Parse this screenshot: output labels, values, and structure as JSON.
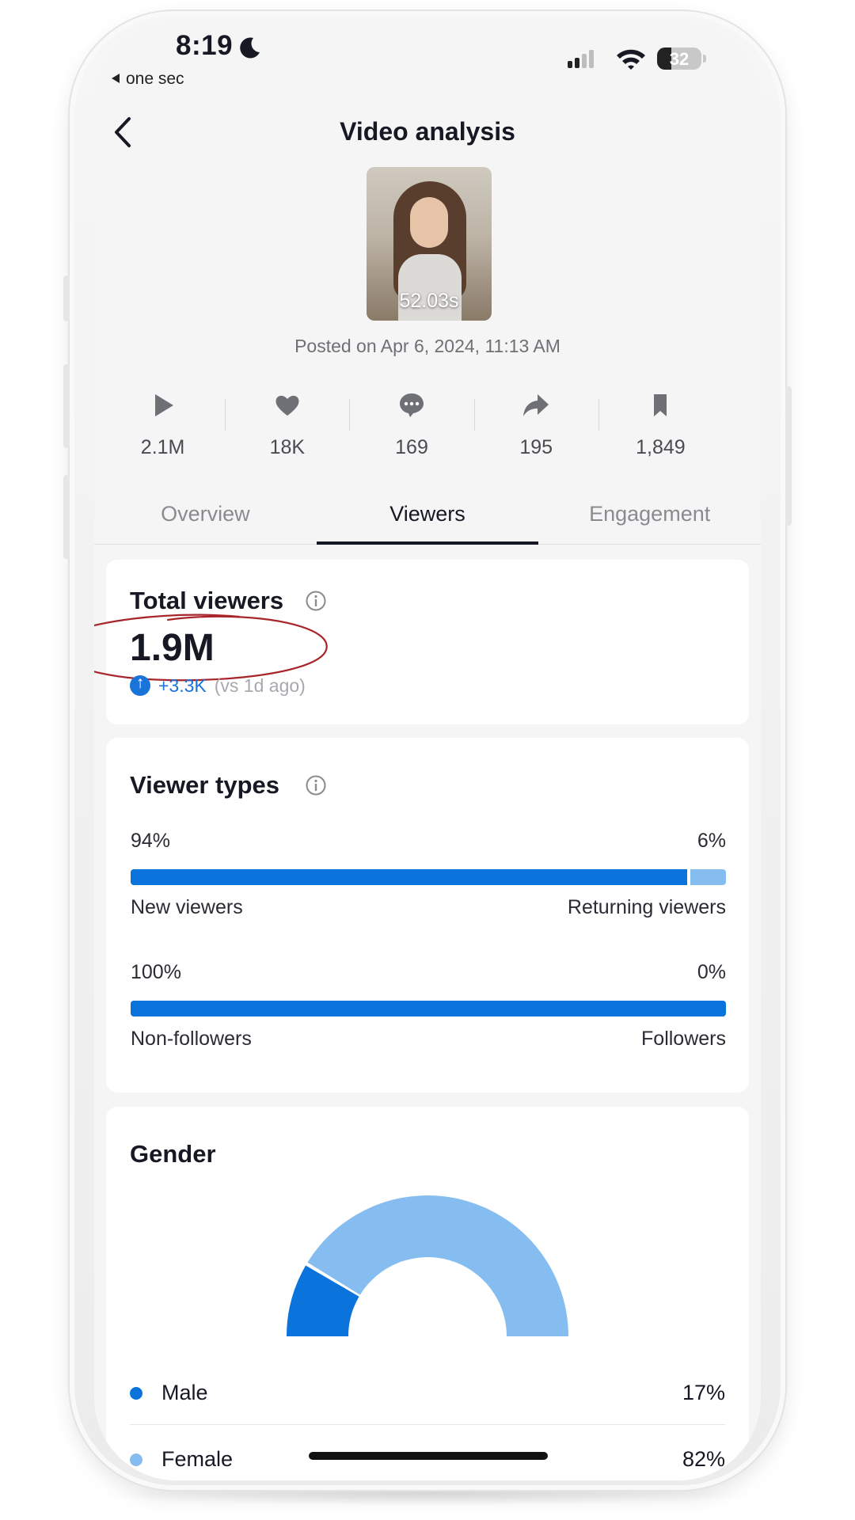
{
  "status_bar": {
    "time": "8:19",
    "back_app": "one sec",
    "battery": "32"
  },
  "header": {
    "title": "Video analysis"
  },
  "video": {
    "duration": "52.03s",
    "posted": "Posted on Apr 6, 2024, 11:13 AM"
  },
  "stats": [
    {
      "icon": "play-icon",
      "value": "2.1M"
    },
    {
      "icon": "heart-icon",
      "value": "18K"
    },
    {
      "icon": "comment-icon",
      "value": "169"
    },
    {
      "icon": "share-icon",
      "value": "195"
    },
    {
      "icon": "bookmark-icon",
      "value": "1,849"
    }
  ],
  "tabs": [
    {
      "label": "Overview",
      "active": false
    },
    {
      "label": "Viewers",
      "active": true
    },
    {
      "label": "Engagement",
      "active": false
    }
  ],
  "total_viewers": {
    "title": "Total viewers",
    "value": "1.9M",
    "delta": "+3.3K",
    "comparison": "(vs 1d ago)"
  },
  "viewer_types": {
    "title": "Viewer types",
    "rows": [
      {
        "left_pct": "94%",
        "right_pct": "6%",
        "left_label": "New viewers",
        "right_label": "Returning viewers",
        "left_share": 94,
        "right_share": 6
      },
      {
        "left_pct": "100%",
        "right_pct": "0%",
        "left_label": "Non-followers",
        "right_label": "Followers",
        "left_share": 100,
        "right_share": 0
      }
    ]
  },
  "gender": {
    "title": "Gender",
    "items": [
      {
        "label": "Male",
        "pct": "17%",
        "share": 17,
        "color": "#0b74dc"
      },
      {
        "label": "Female",
        "pct": "82%",
        "share": 82,
        "color": "#86bdf0"
      }
    ]
  },
  "colors": {
    "accent": "#0b74dc",
    "accent_light": "#86bdf0",
    "annotation": "#a8262b"
  }
}
